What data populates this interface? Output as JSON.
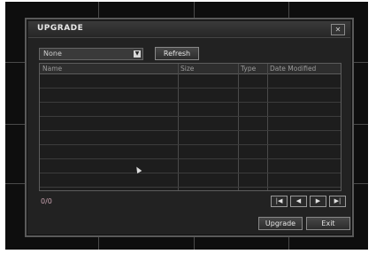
{
  "dialog": {
    "title": "UPGRADE",
    "close_icon": "close-icon"
  },
  "device_select": {
    "value": "None",
    "arrow_icon": "chevron-down-icon"
  },
  "refresh_label": "Refresh",
  "table": {
    "columns": [
      "Name",
      "Size",
      "Type",
      "Date Modified"
    ],
    "rows": []
  },
  "status": "0/0",
  "pager": {
    "first_icon": "first-page-icon",
    "prev_icon": "prev-page-icon",
    "next_icon": "next-page-icon",
    "last_icon": "last-page-icon"
  },
  "actions": {
    "upgrade_label": "Upgrade",
    "exit_label": "Exit"
  },
  "colors": {
    "background": "#0e0e0e",
    "dialog": "#222222",
    "status_text": "#c9a3b0"
  }
}
